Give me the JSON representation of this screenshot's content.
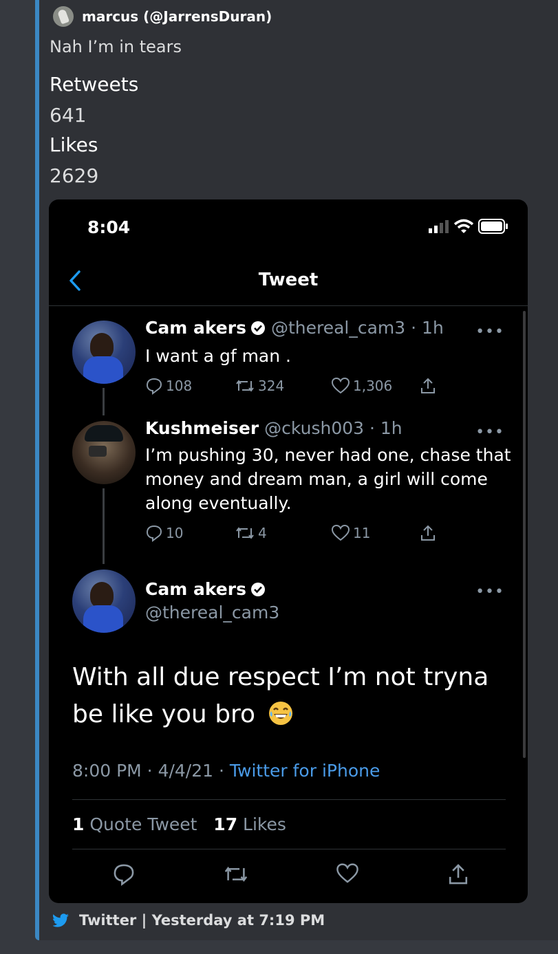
{
  "embed": {
    "author_name": "marcus (@JarrensDuran)",
    "description": "Nah I’m in tears",
    "fields": [
      {
        "name": "Retweets",
        "value": "641"
      },
      {
        "name": "Likes",
        "value": "2629"
      }
    ],
    "footer": "Twitter | Yesterday at 7:19 PM",
    "accent_color": "#3b88c3"
  },
  "phone": {
    "status_time": "8:04",
    "nav_title": "Tweet",
    "thread": [
      {
        "name": "Cam akers",
        "verified": true,
        "handle": "@thereal_cam3 · 1h",
        "text": "I want a gf man .",
        "replies": "108",
        "retweets": "324",
        "likes": "1,306"
      },
      {
        "name": "Kushmeiser",
        "verified": false,
        "handle": "@ckush003 · 1h",
        "text": "I’m pushing 30, never had one, chase that money and dream man, a girl will come along eventually.",
        "replies": "10",
        "retweets": "4",
        "likes": "11"
      }
    ],
    "main_tweet": {
      "name": "Cam akers",
      "handle": "@thereal_cam3",
      "text": "With all due respect I’m not tryna be like you bro",
      "time": "8:00 PM · 4/4/21 · ",
      "source": "Twitter for iPhone",
      "quote_count": "1",
      "quote_label": "Quote Tweet",
      "likes_count": "17",
      "likes_label": "Likes"
    },
    "more_label": "•••"
  },
  "icons": [
    "author-avatar",
    "signal-icon",
    "wifi-icon",
    "battery-icon",
    "back-icon",
    "verified-icon",
    "more-icon",
    "reply-icon",
    "retweet-icon",
    "like-icon",
    "share-icon",
    "laughing-emoji",
    "twitter-bird-icon"
  ]
}
